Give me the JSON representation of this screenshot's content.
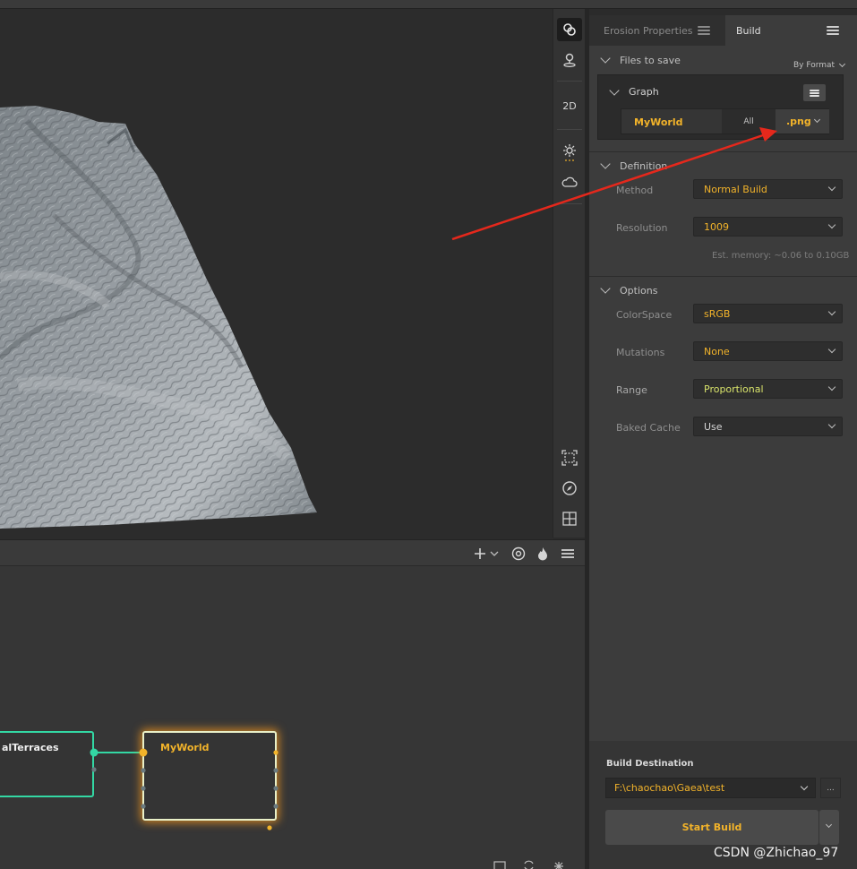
{
  "panel": {
    "tabs": [
      {
        "label": "Erosion Properties",
        "active": false
      },
      {
        "label": "Build",
        "active": true
      }
    ],
    "files_to_save": {
      "title": "Files to save",
      "group_by": "By Format",
      "graph_title": "Graph",
      "row": {
        "name": "MyWorld",
        "scope": "All",
        "format": ".png"
      }
    },
    "definition": {
      "title": "Definition",
      "method_label": "Method",
      "method_value": "Normal Build",
      "resolution_label": "Resolution",
      "resolution_value": "1009",
      "memory_text": "Est. memory: ~0.06 to 0.10GB"
    },
    "options": {
      "title": "Options",
      "colorspace_label": "ColorSpace",
      "colorspace_value": "sRGB",
      "mutations_label": "Mutations",
      "mutations_value": "None",
      "range_label": "Range",
      "range_value": "Proportional",
      "baked_label": "Baked Cache",
      "baked_value": "Use"
    },
    "build_destination": {
      "label": "Build Destination",
      "path": "F:\\chaochao\\Gaea\\test",
      "browse": "...",
      "start_label": "Start Build"
    }
  },
  "viewport_toolbar": {
    "mode_2d_label": "2D",
    "icons": [
      "link-icon",
      "pin-icon",
      "sun-icon",
      "cloud-icon",
      "frame-icon",
      "compass-icon",
      "grid-icon"
    ]
  },
  "graph_toolbar": {
    "icons": [
      "plus-icon",
      "chevron-down-icon",
      "at-icon",
      "flame-icon",
      "menu-icon"
    ]
  },
  "graph": {
    "nodes": [
      {
        "title": "alTerraces"
      },
      {
        "title": "MyWorld"
      }
    ]
  },
  "watermark": "CSDN @Zhichao_97",
  "colors": {
    "accent_yellow": "#f2b32a",
    "node_green": "#33d8a4",
    "arrow_red": "#e5281c"
  }
}
